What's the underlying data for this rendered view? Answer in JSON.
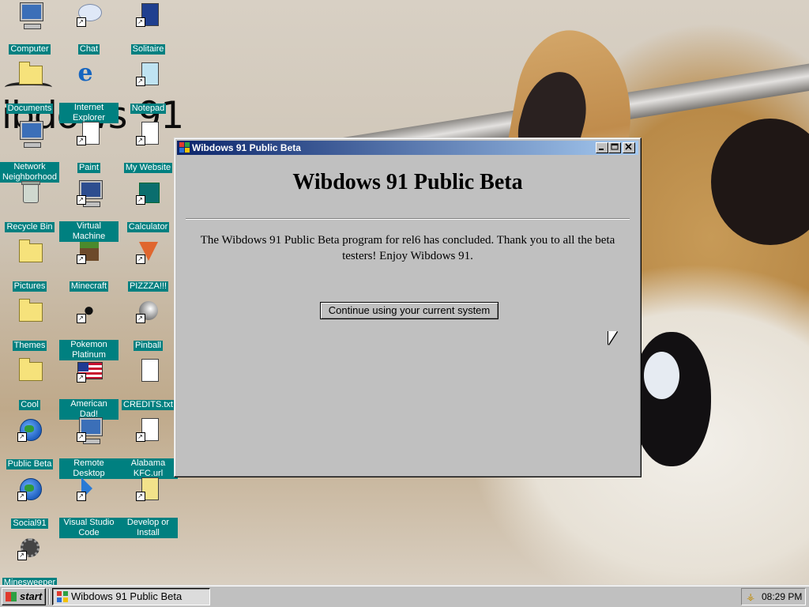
{
  "wallpaper": {
    "scrawl_text": "ibdows 91"
  },
  "desktop_icons": [
    {
      "label": "Computer",
      "icon": "computer-icon",
      "shortcut": false
    },
    {
      "label": "Chat",
      "icon": "chat-icon",
      "shortcut": true
    },
    {
      "label": "Solitaire",
      "icon": "solitaire-icon",
      "shortcut": true
    },
    {
      "label": "Documents",
      "icon": "documents-folder-icon",
      "shortcut": false
    },
    {
      "label": "Internet Explorer",
      "icon": "internet-explorer-icon",
      "shortcut": false
    },
    {
      "label": "Notepad",
      "icon": "notepad-icon",
      "shortcut": true
    },
    {
      "label": "Network Neighborhood",
      "icon": "network-icon",
      "shortcut": false
    },
    {
      "label": "Paint",
      "icon": "paint-icon",
      "shortcut": true
    },
    {
      "label": "My Website",
      "icon": "website-icon",
      "shortcut": true
    },
    {
      "label": "Recycle Bin",
      "icon": "recycle-bin-icon",
      "shortcut": false
    },
    {
      "label": "Virtual Machine",
      "icon": "virtual-machine-icon",
      "shortcut": true
    },
    {
      "label": "Calculator",
      "icon": "calculator-icon",
      "shortcut": true
    },
    {
      "label": "Pictures",
      "icon": "folder-icon",
      "shortcut": false
    },
    {
      "label": "Minecraft",
      "icon": "minecraft-icon",
      "shortcut": true
    },
    {
      "label": "PIZZZA!!!",
      "icon": "pizza-icon",
      "shortcut": true
    },
    {
      "label": "Themes",
      "icon": "folder-icon",
      "shortcut": false
    },
    {
      "label": "Pokemon Platinum",
      "icon": "pokemon-icon",
      "shortcut": true
    },
    {
      "label": "Pinball",
      "icon": "pinball-icon",
      "shortcut": true
    },
    {
      "label": "Cool",
      "icon": "folder-icon",
      "shortcut": false
    },
    {
      "label": "American Dad!",
      "icon": "american-flag-icon",
      "shortcut": true
    },
    {
      "label": "CREDITS.txt",
      "icon": "text-file-icon",
      "shortcut": false
    },
    {
      "label": "Public Beta",
      "icon": "public-beta-icon",
      "shortcut": true
    },
    {
      "label": "Remote Desktop",
      "icon": "remote-desktop-icon",
      "shortcut": true
    },
    {
      "label": "Alabama KFC.url",
      "icon": "internet-shortcut-icon",
      "shortcut": true
    },
    {
      "label": "Social91",
      "icon": "globe-icon",
      "shortcut": true
    },
    {
      "label": "Visual Studio Code",
      "icon": "vscode-icon",
      "shortcut": true
    },
    {
      "label": "Develop or Install",
      "icon": "develop-icon",
      "shortcut": true
    },
    {
      "label": "Minesweeper",
      "icon": "minesweeper-icon",
      "shortcut": true
    }
  ],
  "window": {
    "title": "Wibdows 91 Public Beta",
    "heading": "Wibdows 91 Public Beta",
    "message": "The Wibdows 91 Public Beta program for rel6 has concluded. Thank you to all the beta testers! Enjoy Wibdows 91.",
    "continue_button": "Continue using your current system",
    "controls": {
      "minimize": "minimize-icon",
      "maximize": "maximize-icon",
      "close": "close-icon"
    }
  },
  "taskbar": {
    "start_label": "start",
    "task_label": "Wibdows 91 Public Beta",
    "clock": "08:29 PM"
  },
  "colors": {
    "desktop_label_bg": "#008080",
    "title_bar_start": "#0a246a",
    "title_bar_end": "#a6caf0",
    "window_face": "#c0c0c0"
  }
}
